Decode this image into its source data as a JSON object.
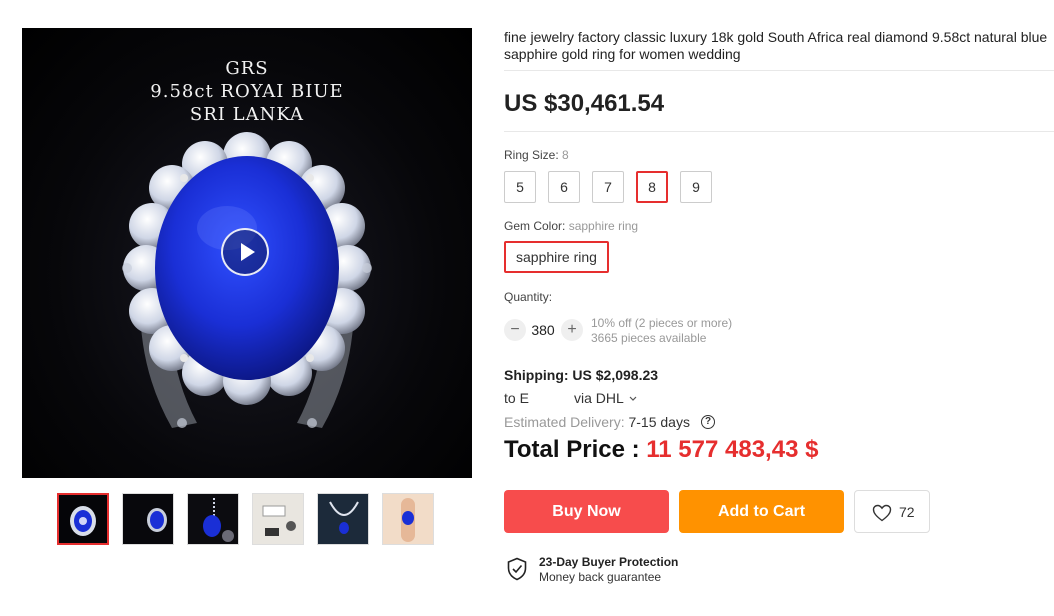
{
  "gallery": {
    "overlay_lines": [
      "GRS",
      "9.58ct ROYAI BIUE",
      "SRI LANKA"
    ],
    "selected_thumb": 0,
    "thumb_count": 6
  },
  "product": {
    "title": "fine jewelry factory classic luxury 18k gold South Africa real diamond 9.58ct natural blue sapphire gold ring for women wedding",
    "price": "US $30,461.54"
  },
  "ring_size": {
    "label": "Ring Size:",
    "selected": "8",
    "options": [
      "5",
      "6",
      "7",
      "8",
      "9"
    ]
  },
  "gem_color": {
    "label": "Gem Color:",
    "selected": "sapphire ring",
    "option": "sapphire ring"
  },
  "quantity": {
    "label": "Quantity:",
    "minus": "−",
    "value": "380",
    "plus": "+",
    "discount_note": "10% off (2 pieces or more)",
    "available": "3665 pieces available"
  },
  "shipping": {
    "label": "Shipping: US $2,098.23",
    "to": "to E",
    "via": "via DHL",
    "estimate_label": "Estimated Delivery:",
    "estimate_days": "7-15 days"
  },
  "total": {
    "label": "Total Price :",
    "amount": "11 577 483,43 $"
  },
  "actions": {
    "buy_now": "Buy Now",
    "add_to_cart": "Add to Cart",
    "wishlist_count": "72"
  },
  "protection": {
    "title": "23-Day Buyer Protection",
    "subtitle": "Money back guarantee"
  },
  "colors": {
    "accent_red": "#e62e2e",
    "buy_button": "#f74c4c",
    "cart_button": "#ff9200",
    "sapphire": "#1a2fd6"
  },
  "icons": {
    "play": "play-icon",
    "chevron": "chevron-down-icon",
    "help": "help-circle-icon",
    "heart": "heart-icon",
    "shield": "shield-check-icon"
  }
}
